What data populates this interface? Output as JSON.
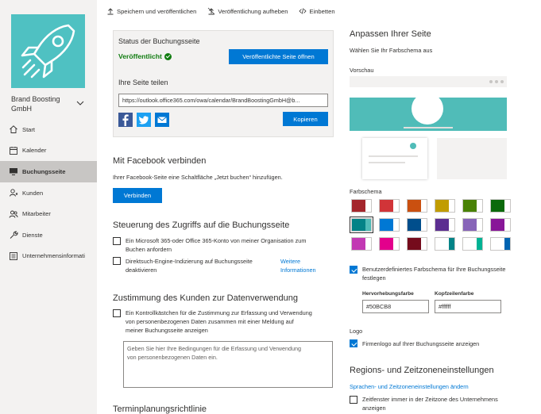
{
  "toolbar": {
    "save_publish": "Speichern und veröffentlichen",
    "unpublish": "Veröffentlichung aufheben",
    "embed": "Einbetten"
  },
  "sidebar": {
    "business_name": "Brand Boosting GmbH",
    "items": [
      {
        "label": "Start",
        "icon": "home-icon"
      },
      {
        "label": "Kalender",
        "icon": "calendar-icon"
      },
      {
        "label": "Buchungsseite",
        "icon": "monitor-icon",
        "active": true
      },
      {
        "label": "Kunden",
        "icon": "person-icon"
      },
      {
        "label": "Mitarbeiter",
        "icon": "people-icon"
      },
      {
        "label": "Dienste",
        "icon": "wrench-icon"
      },
      {
        "label": "Unternehmensinformati",
        "icon": "building-icon"
      }
    ]
  },
  "status": {
    "title": "Status der Buchungsseite",
    "published": "Veröffentlicht",
    "open_button": "Veröffentlichte Seite öffnen",
    "share_title": "Ihre Seite teilen",
    "url": "https://outlook.office365.com/owa/calendar/BrandBoostingGmbH@b...",
    "copy_button": "Kopieren"
  },
  "facebook": {
    "title": "Mit Facebook verbinden",
    "description": "Ihrer Facebook-Seite eine Schaltfläche „Jetzt buchen“ hinzufügen.",
    "connect_button": "Verbinden"
  },
  "access": {
    "title": "Steuerung des Zugriffs auf die Buchungsseite",
    "opt1_line1": "Ein Microsoft 365-oder Office 365-Konto von meiner Organisation zum",
    "opt1_line2": "Buchen anfordern",
    "opt2_line1": "Direktsuch-Engine-Indizierung auf Buchungsseite",
    "opt2_line2": "deaktivieren",
    "more_info_line1": "Weitere",
    "more_info_line2": "Informationen"
  },
  "consent": {
    "title": "Zustimmung des Kunden zur Datenverwendung",
    "cb_line1": "Ein Kontrollkästchen für die Zustimmung zur Erfassung und Verwendung",
    "cb_line2": "von personenbezogenen Daten zusammen mit einer Meldung auf",
    "cb_line3": "meiner Buchungsseite anzeigen",
    "placeholder_line1": "Geben Sie hier Ihre Bedingungen für die Erfassung und Verwendung",
    "placeholder_line2": "von personenbezogenen Daten ein."
  },
  "scheduling": {
    "title": "Terminplanungsrichtlinie"
  },
  "customize": {
    "title": "Anpassen Ihrer Seite",
    "subtitle": "Wählen Sie Ihr Farbschema aus",
    "preview_label": "Vorschau",
    "scheme_label": "Farbschema",
    "swatches": [
      [
        "#a4262c",
        "#ffffff"
      ],
      [
        "#d13438",
        "#ffffff"
      ],
      [
        "#ca5010",
        "#ffffff"
      ],
      [
        "#c19c00",
        "#ffffff"
      ],
      [
        "#498205",
        "#ffffff"
      ],
      [
        "#0b6a0b",
        "#ffffff"
      ],
      [
        "#038387",
        "#50bcb8"
      ],
      [
        "#0078d4",
        "#ffffff"
      ],
      [
        "#004e8c",
        "#ffffff"
      ],
      [
        "#5c2e91",
        "#ffffff"
      ],
      [
        "#8764b8",
        "#ffffff"
      ],
      [
        "#881798",
        "#ffffff"
      ],
      [
        "#c239b3",
        "#ffffff"
      ],
      [
        "#e3008c",
        "#ffffff"
      ],
      [
        "#750b1c",
        "#ffffff"
      ],
      [
        "#ffffff",
        "#038387"
      ],
      [
        "#ffffff",
        "#00b294"
      ],
      [
        "#ffffff",
        "#0063b1"
      ]
    ],
    "custom_scheme_line1": "Benutzerdefiniertes Farbschema für Ihre Buchungsseite",
    "custom_scheme_line2": "festlegen",
    "highlight_label": "Hervorhebungsfarbe",
    "highlight_value": "#50BCB8",
    "header_label": "Kopfzeilenfarbe",
    "header_value": "#ffffff",
    "logo_label": "Logo",
    "logo_cb": "Firmenlogo auf Ihrer Buchungsseite anzeigen"
  },
  "region": {
    "title": "Regions- und Zeitzoneneinstellungen",
    "link": "Sprachen- und Zeitzoneneinstellungen ändern",
    "cb_line1": "Zeitfenster immer in der Zeitzone des Unternehmens",
    "cb_line2": "anzeigen"
  },
  "colors": {
    "accent": "#0078d4",
    "success": "#107c10",
    "logo_bg": "#4fc1c2"
  }
}
